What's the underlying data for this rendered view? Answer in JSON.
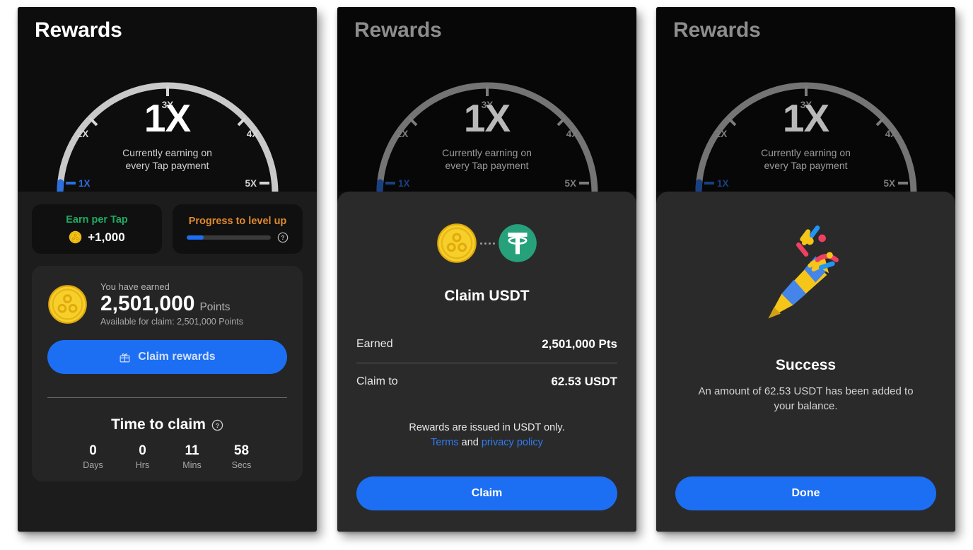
{
  "gauge": {
    "title": "Rewards",
    "multiplier": "1X",
    "subtitle_line1": "Currently earning on",
    "subtitle_line2": "every Tap payment",
    "ticks": [
      "1X",
      "2X",
      "3X",
      "4X",
      "5X"
    ],
    "active_tick": "1X",
    "accent_blue": "#2b6fe0",
    "arc_color": "#c9c9c9"
  },
  "panel1": {
    "earn_per_tap": {
      "label": "Earn per Tap",
      "value": "+1,000",
      "color": "#1fab63",
      "coin_icon": "gold-coin-icon"
    },
    "progress": {
      "label": "Progress to level up",
      "percent": 20,
      "color": "#e08a2e",
      "help_icon": "question-circle-icon"
    },
    "earned_card": {
      "caption": "You have earned",
      "amount": "2,501,000",
      "unit": "Points",
      "available": "Available for claim: 2,501,000 Points",
      "coin_icon": "gold-coin-icon"
    },
    "claim_button": {
      "label": "Claim rewards",
      "icon": "gift-icon",
      "color": "#1c6ef2"
    },
    "time_to_claim": {
      "title": "Time to claim",
      "help_icon": "question-circle-icon",
      "units": [
        {
          "value": "0",
          "label": "Days"
        },
        {
          "value": "0",
          "label": "Hrs"
        },
        {
          "value": "11",
          "label": "Mins"
        },
        {
          "value": "58",
          "label": "Secs"
        }
      ]
    }
  },
  "panel2": {
    "icons": {
      "from": "gold-coin-icon",
      "to": "tether-usdt-icon"
    },
    "title": "Claim USDT",
    "rows": [
      {
        "key": "Earned",
        "value": "2,501,000 Pts"
      },
      {
        "key": "Claim to",
        "value": "62.53 USDT"
      }
    ],
    "legal_text": "Rewards are issued in USDT only.",
    "legal_terms": "Terms",
    "legal_and": "and",
    "legal_privacy": "privacy policy",
    "claim_button": "Claim"
  },
  "panel3": {
    "icon": "party-popper-icon",
    "title": "Success",
    "message": "An amount of 62.53 USDT has been added to your balance.",
    "done_button": "Done"
  }
}
